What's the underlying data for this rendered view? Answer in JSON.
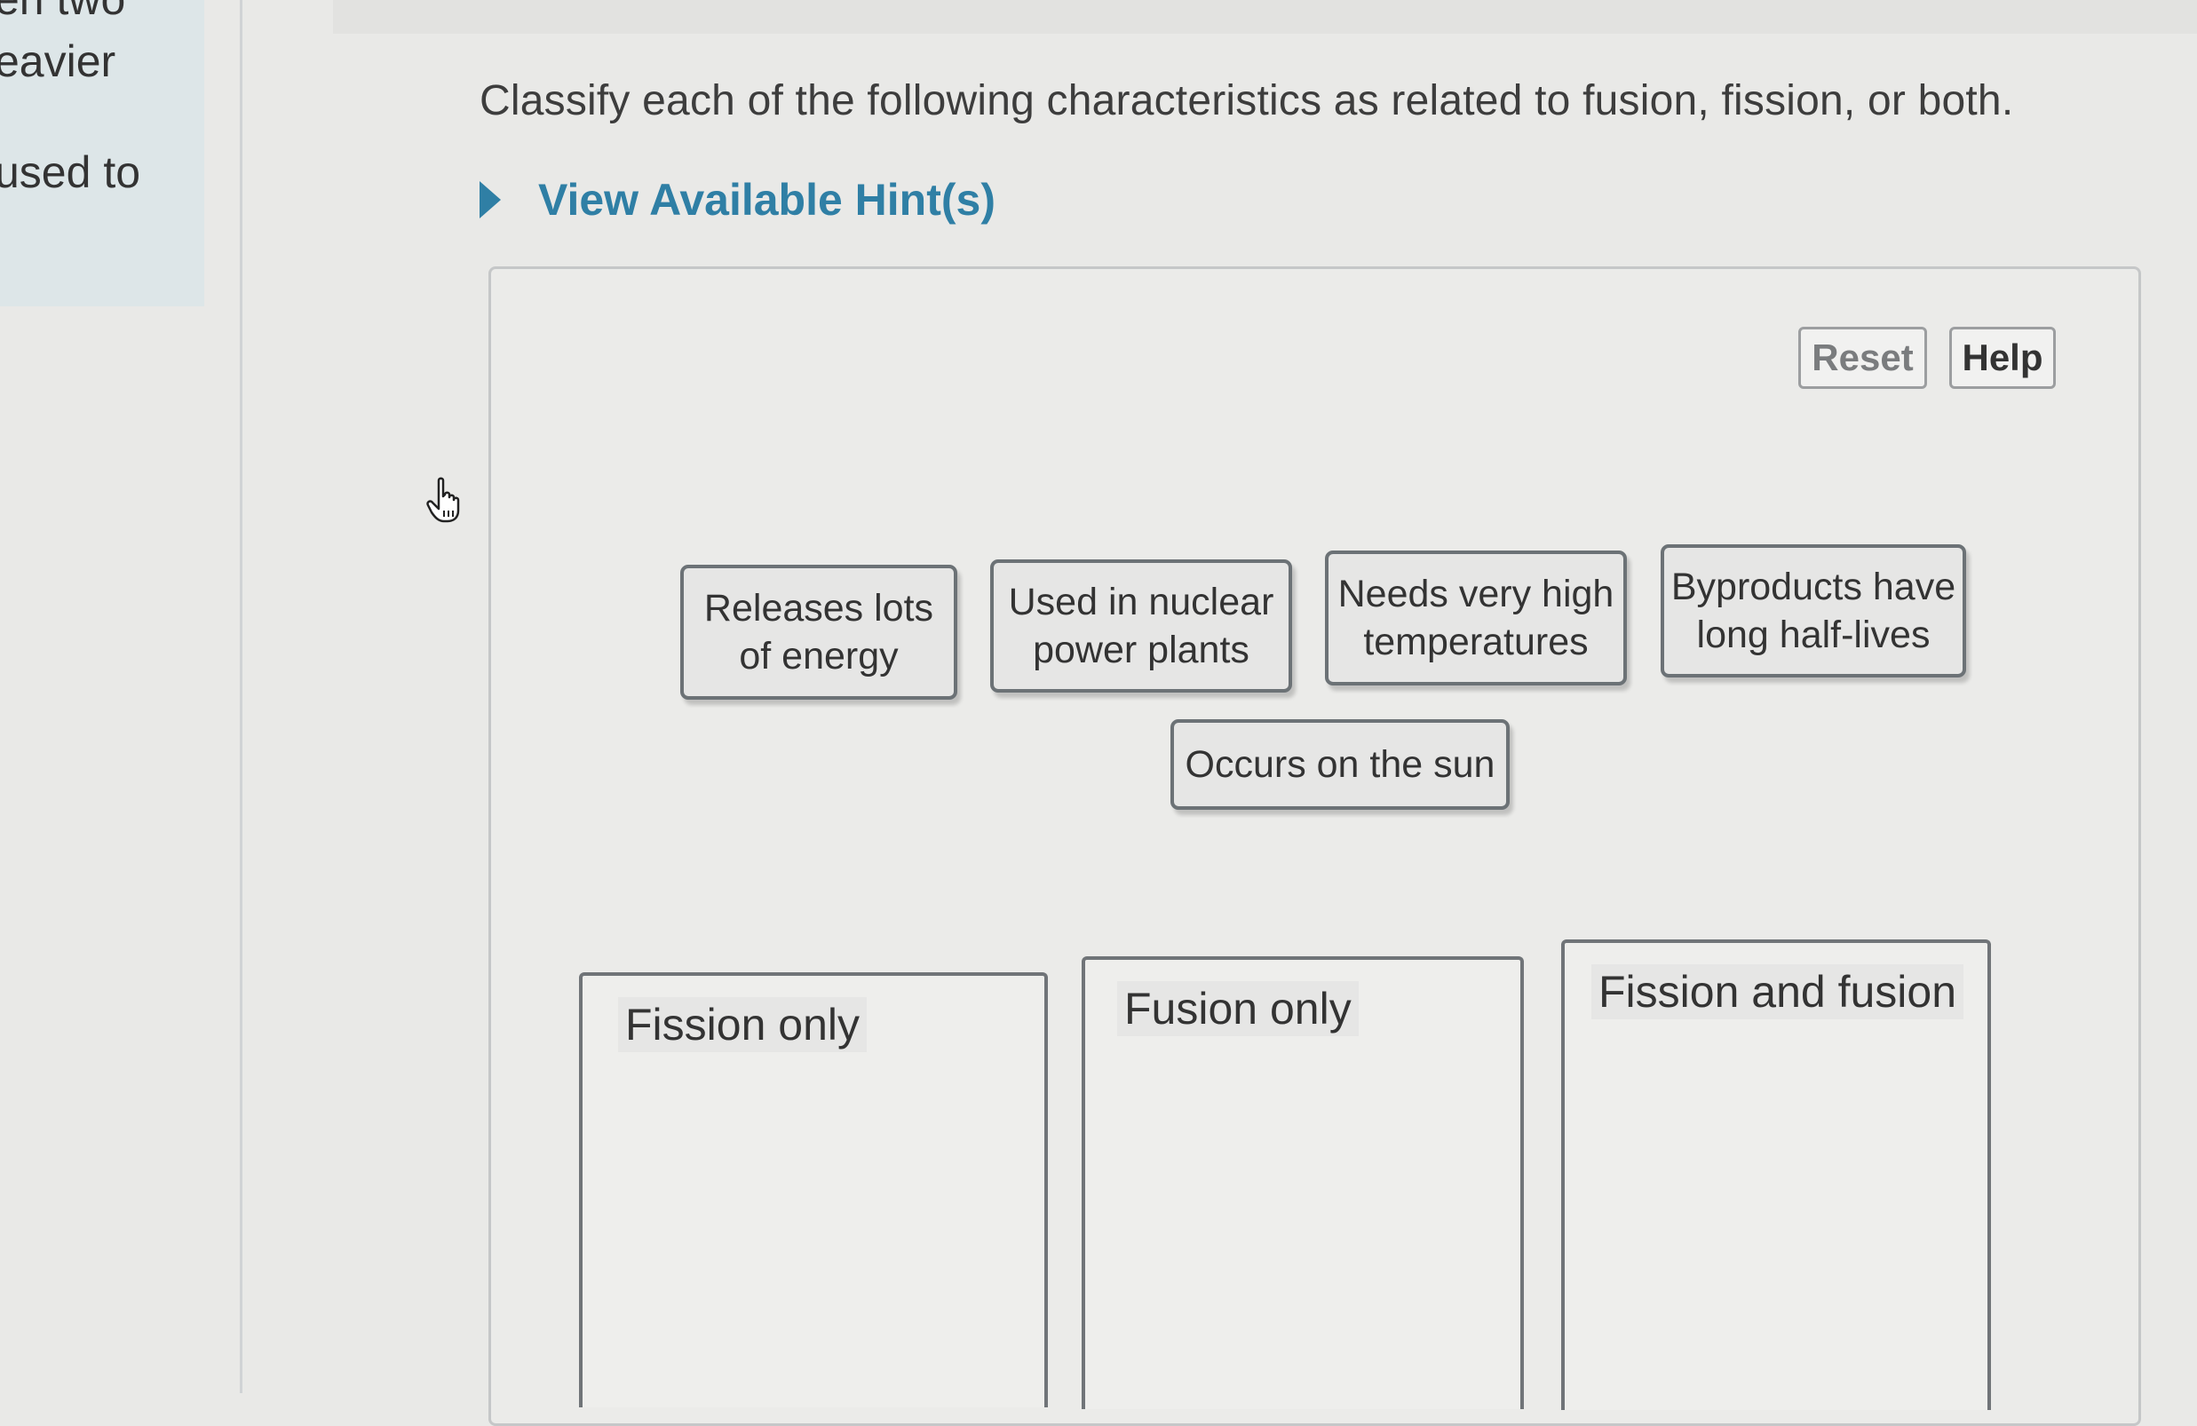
{
  "sidebar": {
    "lines": [
      "en two",
      "eavier",
      "used to"
    ]
  },
  "question": {
    "text": "Classify each of the following characteristics as related to fusion, fission, or both."
  },
  "hint": {
    "label": "View Available Hint(s)",
    "icon": "triangle-right-icon"
  },
  "toolbar": {
    "reset_label": "Reset",
    "help_label": "Help"
  },
  "draggables": [
    {
      "line1": "Releases lots",
      "line2": "of energy"
    },
    {
      "line1": "Used in nuclear",
      "line2": "power plants"
    },
    {
      "line1": "Needs very high",
      "line2": "temperatures"
    },
    {
      "line1": "Byproducts have",
      "line2": "long half-lives"
    },
    {
      "line1": "Occurs on the sun",
      "line2": ""
    }
  ],
  "bins": [
    {
      "label": "Fission only"
    },
    {
      "label": "Fusion only"
    },
    {
      "label": "Fission and fusion"
    }
  ],
  "colors": {
    "accent": "#2f7fa5",
    "chip_border": "#6c7276",
    "page_bg": "#e9e9e7"
  },
  "cursor": {
    "icon": "hand-pointer-icon"
  }
}
